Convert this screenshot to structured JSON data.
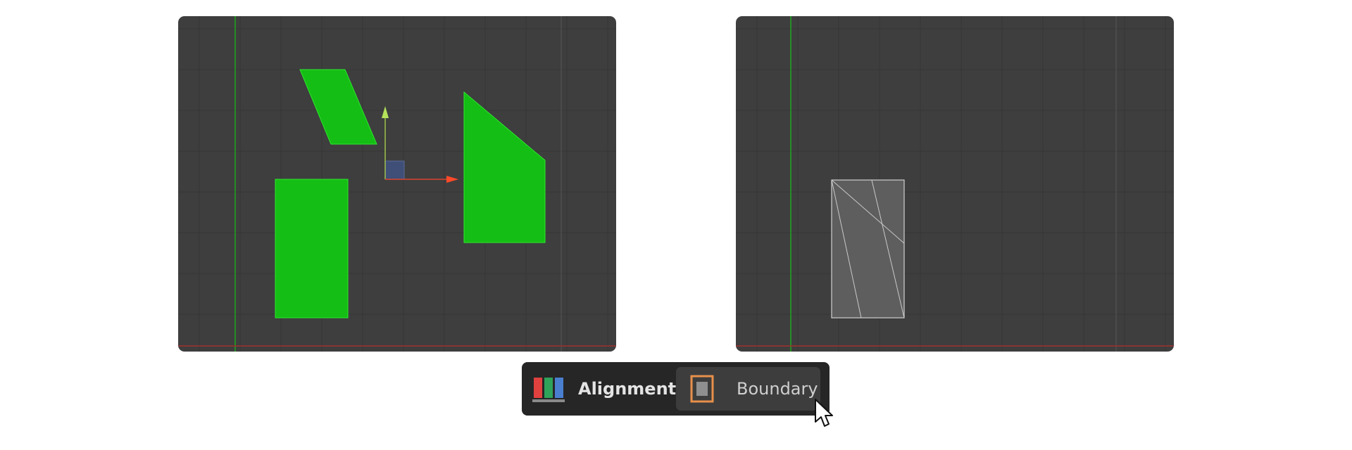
{
  "viewports": {
    "left": {
      "name": "viewport-before"
    },
    "right": {
      "name": "viewport-after"
    }
  },
  "toolbar": {
    "alignment": {
      "label": "Alignment",
      "icon": "alignment-icon",
      "icon_colors": [
        "#e0413f",
        "#2fa35a",
        "#4a7fd0"
      ]
    },
    "boundary": {
      "label": "Boundary",
      "icon": "boundary-icon",
      "selected": true,
      "accent": "#e8904a"
    }
  },
  "colors": {
    "viewport_bg": "#3e3e3e",
    "shape_fill": "#14be14",
    "x_axis": "#e0453a",
    "y_axis": "#b4e25a",
    "toolbar_bg": "#262626"
  }
}
